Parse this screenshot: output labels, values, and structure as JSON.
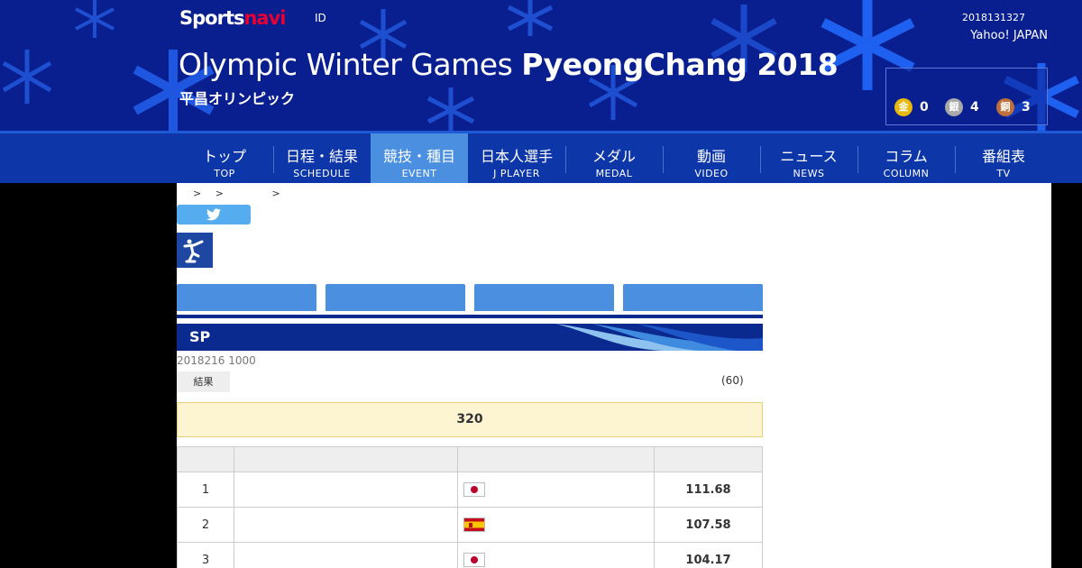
{
  "header": {
    "logo_main": "Sports",
    "logo_accent": "navi",
    "id_link": "ID",
    "date": "2018131327",
    "yahoo": "Yahoo! JAPAN",
    "title_light": "Olympic Winter Games ",
    "title_bold": "PyeongChang 2018",
    "subtitle": "平昌オリンピック"
  },
  "medals": {
    "gold": {
      "icon": "金",
      "count": "0",
      "color": "#e8b90a"
    },
    "silver": {
      "icon": "銀",
      "count": "4",
      "color": "#a9a9a9"
    },
    "bronze": {
      "icon": "銅",
      "count": "3",
      "color": "#c0703a"
    }
  },
  "nav": [
    {
      "jp": "トップ",
      "en": "TOP"
    },
    {
      "jp": "日程・結果",
      "en": "SCHEDULE"
    },
    {
      "jp": "競技・種目",
      "en": "EVENT"
    },
    {
      "jp": "日本人選手",
      "en": "J PLAYER"
    },
    {
      "jp": "メダル",
      "en": "MEDAL"
    },
    {
      "jp": "動画",
      "en": "VIDEO"
    },
    {
      "jp": "ニュース",
      "en": "NEWS"
    },
    {
      "jp": "コラム",
      "en": "COLUMN"
    },
    {
      "jp": "番組表",
      "en": "TV"
    }
  ],
  "breadcrumb": [
    ">",
    ">",
    ">"
  ],
  "event": {
    "banner": "SP",
    "datetime": "2018216 1000",
    "result_label": "結果",
    "count": "(60)",
    "notice": "320"
  },
  "results": [
    {
      "rank": "1",
      "name": "",
      "flag": "japan",
      "score": "111.68"
    },
    {
      "rank": "2",
      "name": "",
      "flag": "spain",
      "score": "107.58"
    },
    {
      "rank": "3",
      "name": "",
      "flag": "japan",
      "score": "104.17"
    }
  ],
  "colors": {
    "header_bg": "#0a1f8f",
    "nav_bg": "#0d37a8",
    "nav_active": "#4b8fe0",
    "accent_red": "#e60033"
  }
}
